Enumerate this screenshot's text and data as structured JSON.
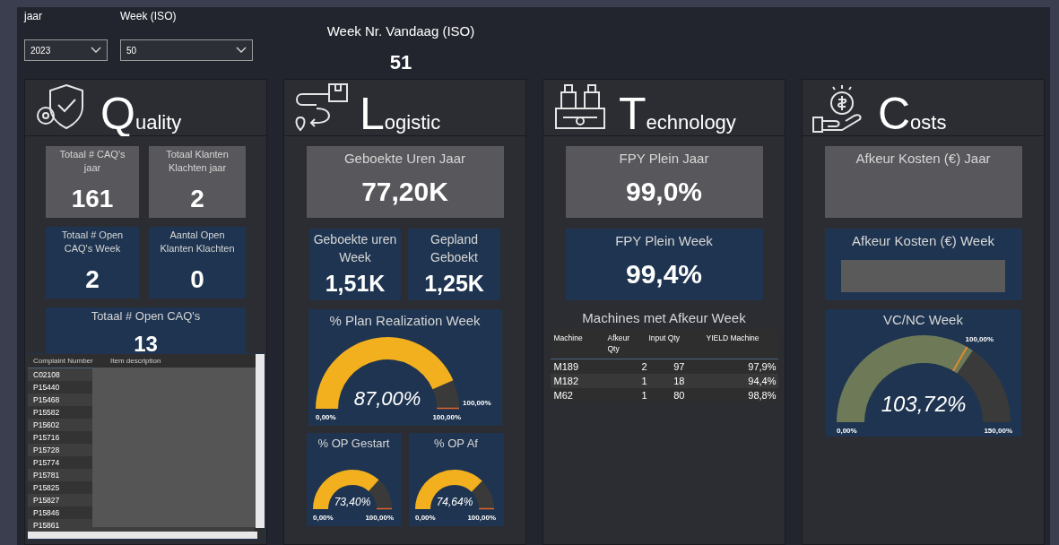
{
  "filters": [
    {
      "label": "jaar",
      "value": "2023"
    },
    {
      "label": "Week (ISO)",
      "value": "50"
    }
  ],
  "today_week": {
    "label": "Week Nr. Vandaag (ISO)",
    "value": "51"
  },
  "sections": [
    {
      "kind": "quality",
      "title": "Quality",
      "cards": [
        {
          "label": "Totaal # CAQ's jaar",
          "value": "161"
        },
        {
          "label": "Totaal Klanten Klachten jaar",
          "value": "2"
        },
        {
          "label": "Totaal # Open CAQ's Week",
          "value": "2"
        },
        {
          "label": "Aantal Open Klanten Klachten",
          "value": "0"
        },
        {
          "label": "Totaal # Open CAQ's",
          "value": "13"
        }
      ],
      "table": {
        "columns": [
          "Complaint Number",
          "Item description"
        ],
        "rows": [
          "C02108",
          "P15440",
          "P15468",
          "P15582",
          "P15602",
          "P15716",
          "P15728",
          "P15774",
          "P15781",
          "P15825",
          "P15827",
          "P15846",
          "P15861"
        ]
      }
    },
    {
      "kind": "logistic",
      "title": "Logistic",
      "cards": [
        {
          "label": "Geboekte Uren Jaar",
          "value": "77,20K"
        },
        {
          "label": "Geboekte uren Week",
          "value": "1,51K"
        },
        {
          "label": "Gepland Geboekt",
          "value": "1,25K"
        }
      ],
      "gauges": [
        {
          "title": "% Plan Realization Week",
          "value": "87,00%",
          "min_label": "0,00%",
          "max_label": "100,00%",
          "target_label": "100,00%"
        },
        {
          "title": "% OP Gestart",
          "value": "73,40%",
          "min_label": "0,00%",
          "max_label": "100,00%"
        },
        {
          "title": "% OP Af",
          "value": "74,64%",
          "min_label": "0,00%",
          "max_label": "100,00%"
        }
      ]
    },
    {
      "kind": "technology",
      "title": "Technology",
      "cards": [
        {
          "label": "FPY Plein Jaar",
          "value": "99,0%"
        },
        {
          "label": "FPY Plein Week",
          "value": "99,4%"
        }
      ],
      "machines": {
        "title": "Machines met Afkeur Week",
        "columns": [
          "Machine",
          "Afkeur Qty",
          "Input Qty",
          "YIELD Machine"
        ],
        "rows": [
          [
            "M189",
            "2",
            "97",
            "97,9%"
          ],
          [
            "M182",
            "1",
            "18",
            "94,4%"
          ],
          [
            "M62",
            "1",
            "80",
            "98,8%"
          ]
        ]
      }
    },
    {
      "kind": "costs",
      "title": "Costs",
      "cards": [
        {
          "label": "Afkeur Kosten (€) Jaar"
        },
        {
          "label": "Afkeur Kosten (€) Week"
        }
      ],
      "gauges": [
        {
          "title": "VC/NC Week",
          "value": "103,72%",
          "min_label": "0,00%",
          "max_label": "150,00%",
          "target_label": "100,00%"
        }
      ]
    }
  ]
}
